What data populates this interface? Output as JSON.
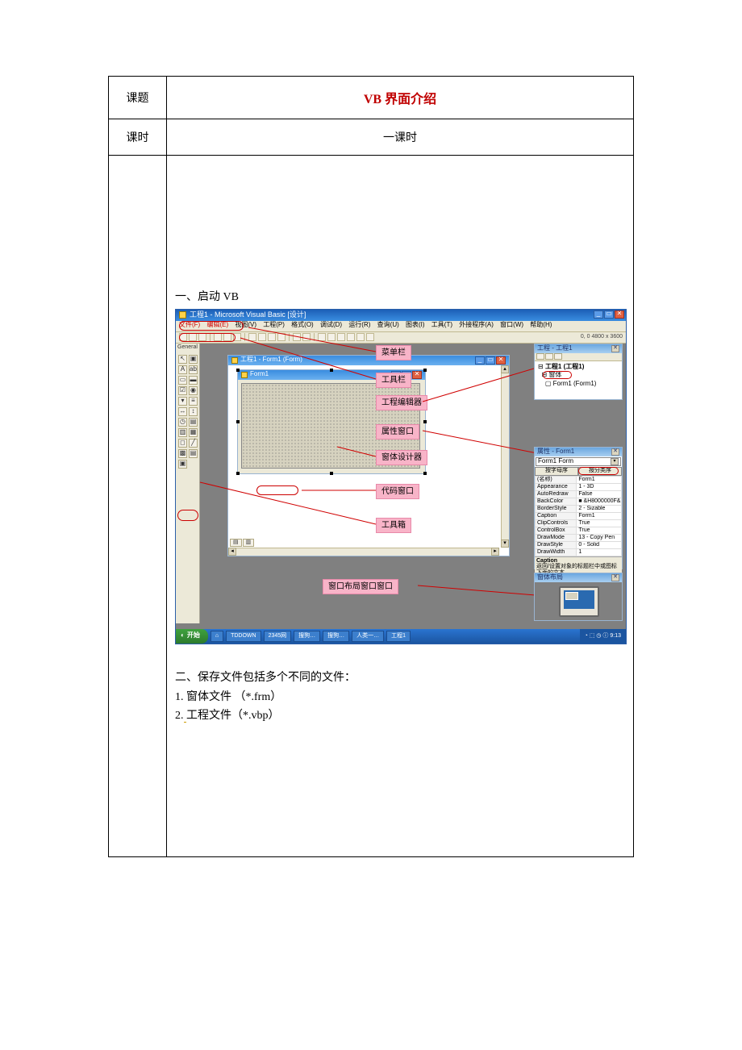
{
  "row1": {
    "label": "课题",
    "title": "VB 界面介绍"
  },
  "row2": {
    "label": "课时",
    "value": "一课时"
  },
  "content": {
    "h_start": "一、启动 VB",
    "h_save": "二、保存文件包括多个不同的文件：",
    "file1": "1. 窗体文件   （*.frm）",
    "file2_a": "2.",
    "file2_b": "工程文件（*.vbp）"
  },
  "vb": {
    "title": "工程1 - Microsoft Visual Basic [设计]",
    "menus": [
      "文件(F)",
      "编辑(E)",
      "视图(V)",
      "工程(P)",
      "格式(O)",
      "调试(D)",
      "运行(R)",
      "查询(U)",
      "图表(I)",
      "工具(T)",
      "外接程序(A)",
      "窗口(W)",
      "帮助(H)"
    ],
    "coord": "0, 0    4800 x 3600",
    "toolbox_hdr": "General",
    "mdi_title": "工程1 - Form1 (Form)",
    "form_title": "Form1",
    "labels": {
      "menubar": "菜单栏",
      "toolbar": "工具栏",
      "project": "工程编辑器",
      "properties": "属性窗口",
      "designer": "窗体设计器",
      "code": "代码窗口",
      "toolbox": "工具箱",
      "layout": "窗口布局窗口窗口"
    },
    "proj": {
      "title": "工程 - 工程1",
      "root": "工程1 (工程1)",
      "folder": "窗体",
      "item": "Form1 (Form1)"
    },
    "props": {
      "title": "属性 - Form1",
      "combo": "Form1 Form",
      "tab1": "按字母序",
      "tab2": "按分类序",
      "rows": [
        [
          "(名称)",
          "Form1"
        ],
        [
          "Appearance",
          "1 - 3D"
        ],
        [
          "AutoRedraw",
          "False"
        ],
        [
          "BackColor",
          "■ &H8000000F&"
        ],
        [
          "BorderStyle",
          "2 - Sizable"
        ],
        [
          "Caption",
          "Form1"
        ],
        [
          "ClipControls",
          "True"
        ],
        [
          "ControlBox",
          "True"
        ],
        [
          "DrawMode",
          "13 - Copy Pen"
        ],
        [
          "DrawStyle",
          "0 - Solid"
        ],
        [
          "DrawWidth",
          "1"
        ]
      ],
      "cap_h": "Caption",
      "cap_t": "返回/设置对象的标题栏中或图标下面的文本。"
    },
    "layout_title": "窗体布局",
    "taskbar": {
      "start": "开始",
      "items": [
        "⌂",
        "TDDOWN",
        "2345网",
        "搜狗…",
        "搜狗…",
        "人类一…",
        "工程1"
      ],
      "tray": "◔ ⬚ ◷ ⓘ  9:13"
    }
  }
}
